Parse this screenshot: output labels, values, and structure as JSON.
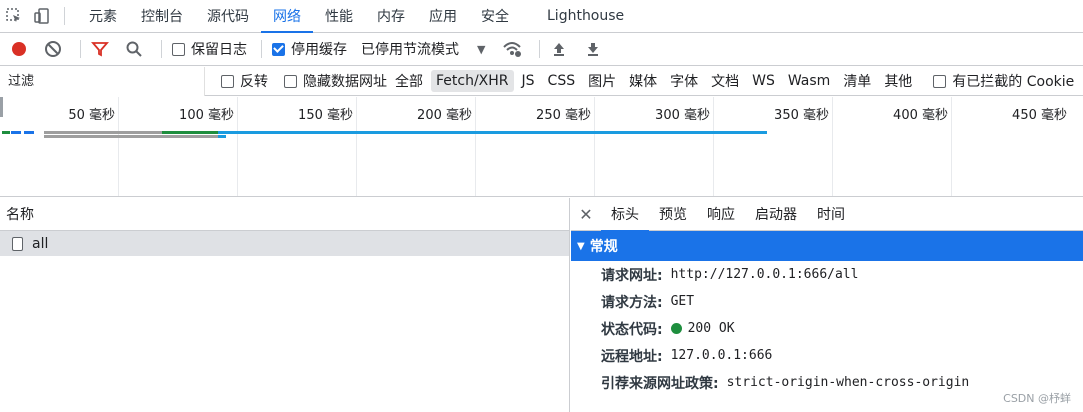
{
  "tabs": [
    "元素",
    "控制台",
    "源代码",
    "网络",
    "性能",
    "内存",
    "应用",
    "安全",
    "Lighthouse"
  ],
  "active_tab": "网络",
  "toolbar": {
    "preserve_log": "保留日志",
    "disable_cache": "停用缓存",
    "throttle": "已停用节流模式"
  },
  "filter": {
    "placeholder": "过滤",
    "invert": "反转",
    "hide_data_urls": "隐藏数据网址",
    "types": [
      "全部",
      "Fetch/XHR",
      "JS",
      "CSS",
      "图片",
      "媒体",
      "字体",
      "文档",
      "WS",
      "Wasm",
      "清单",
      "其他"
    ],
    "active_type": "Fetch/XHR",
    "blocked_cookies": "有已拦截的 Cookie"
  },
  "timeline": {
    "ticks": [
      "50 毫秒",
      "100 毫秒",
      "150 毫秒",
      "200 毫秒",
      "250 毫秒",
      "300 毫秒",
      "350 毫秒",
      "400 毫秒",
      "450 毫秒"
    ]
  },
  "requests": {
    "header": "名称",
    "rows": [
      "all"
    ]
  },
  "details": {
    "tabs": [
      "标头",
      "预览",
      "响应",
      "启动器",
      "时间"
    ],
    "active_tab": "标头",
    "section": "常规",
    "fields": [
      {
        "key": "请求网址:",
        "value": "http://127.0.0.1:666/all"
      },
      {
        "key": "请求方法:",
        "value": "GET"
      },
      {
        "key": "状态代码:",
        "value": "200 OK"
      },
      {
        "key": "远程地址:",
        "value": "127.0.0.1:666"
      },
      {
        "key": "引荐来源网址政策:",
        "value": "strict-origin-when-cross-origin"
      }
    ]
  },
  "watermark": "CSDN @杼蛘",
  "colors": {
    "accent": "#1a73e8",
    "record": "#d93025",
    "status_ok": "#1e8e3e"
  }
}
